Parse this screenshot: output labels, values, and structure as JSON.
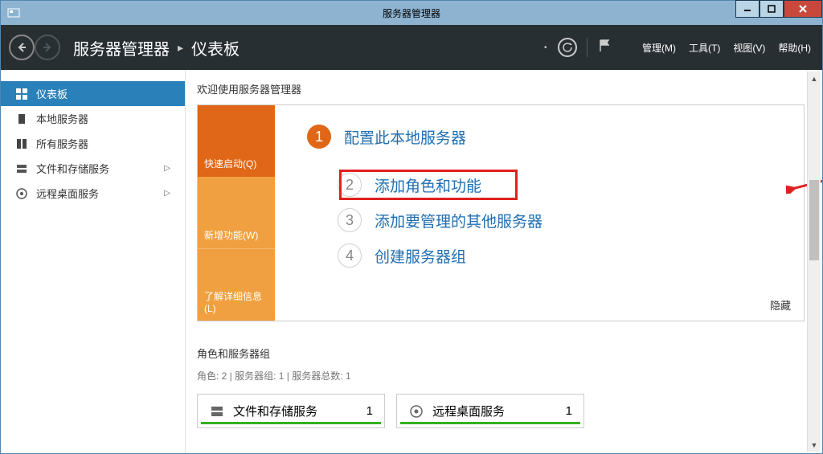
{
  "window": {
    "title": "服务器管理器"
  },
  "nav": {
    "breadcrumb": {
      "root": "服务器管理器",
      "current": "仪表板"
    },
    "menu": {
      "manage": "管理(M)",
      "tools": "工具(T)",
      "view": "视图(V)",
      "help": "帮助(H)"
    }
  },
  "sidebar": {
    "items": [
      {
        "label": "仪表板",
        "icon": "dashboard",
        "active": true
      },
      {
        "label": "本地服务器",
        "icon": "local-server"
      },
      {
        "label": "所有服务器",
        "icon": "all-servers"
      },
      {
        "label": "文件和存储服务",
        "icon": "storage",
        "expandable": true
      },
      {
        "label": "远程桌面服务",
        "icon": "remote-desktop",
        "expandable": true
      }
    ]
  },
  "main": {
    "welcome_title": "欢迎使用服务器管理器",
    "tile_tabs": {
      "quickstart": "快速启动(Q)",
      "whatsnew": "新增功能(W)",
      "learnmore": "了解详细信息(L)"
    },
    "steps": [
      {
        "num": "1",
        "text": "配置此本地服务器",
        "filled": true
      },
      {
        "num": "2",
        "text": "添加角色和功能",
        "highlighted": true
      },
      {
        "num": "3",
        "text": "添加要管理的其他服务器"
      },
      {
        "num": "4",
        "text": "创建服务器组"
      }
    ],
    "hide_label": "隐藏",
    "roles_section": {
      "title": "角色和服务器组",
      "subtitle": "角色: 2 | 服务器组: 1 | 服务器总数: 1",
      "cards": [
        {
          "name": "文件和存储服务",
          "count": "1",
          "icon": "storage"
        },
        {
          "name": "远程桌面服务",
          "count": "1",
          "icon": "remote-desktop"
        }
      ]
    }
  }
}
